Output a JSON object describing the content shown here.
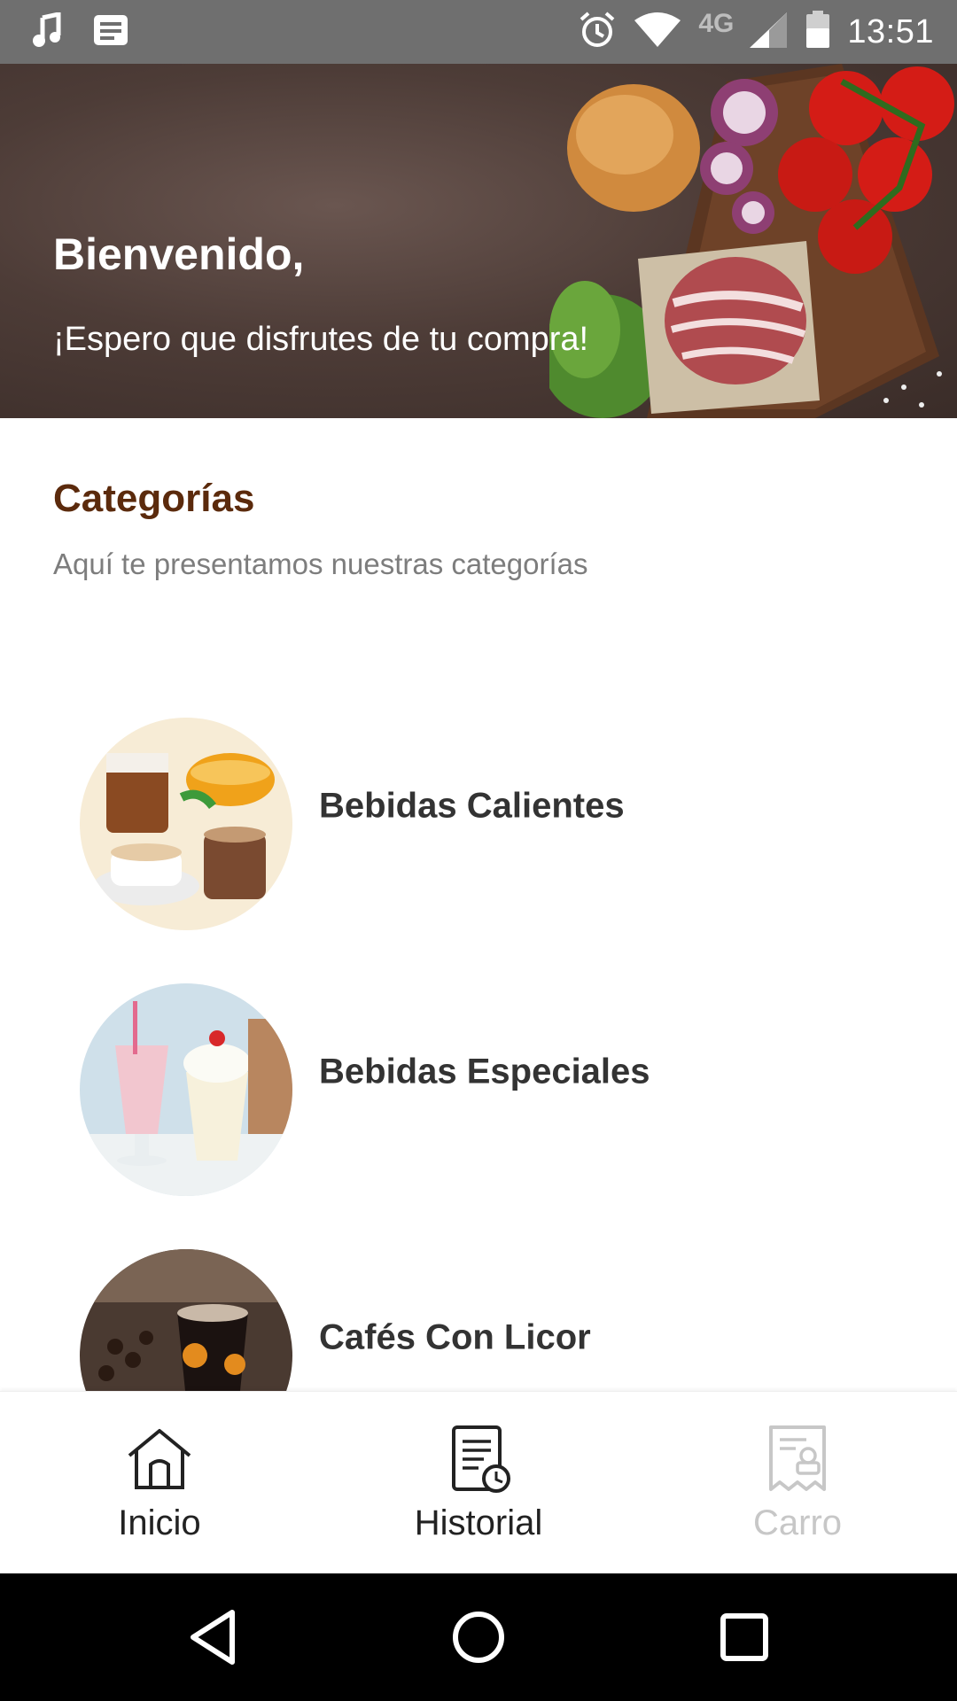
{
  "status_bar": {
    "time": "13:51",
    "network": "4G",
    "icons": [
      "music-note-icon",
      "document-icon",
      "alarm-icon",
      "wifi-icon",
      "cell-signal-icon",
      "battery-icon"
    ]
  },
  "hero": {
    "title": "Bienvenido,",
    "subtitle": "¡Espero que disfrutes de tu compra!"
  },
  "categories": {
    "title": "Categorías",
    "subtitle": "Aquí te presentamos nuestras categorías",
    "items": [
      {
        "label": "Bebidas Calientes"
      },
      {
        "label": "Bebidas Especiales"
      },
      {
        "label": "Cafés Con Licor"
      }
    ]
  },
  "bottom_nav": {
    "items": [
      {
        "label": "Inicio",
        "icon": "home-icon",
        "enabled": true
      },
      {
        "label": "Historial",
        "icon": "history-icon",
        "enabled": true
      },
      {
        "label": "Carro",
        "icon": "cart-receipt-icon",
        "enabled": false
      }
    ]
  },
  "colors": {
    "status_bar": "#6f6f6f",
    "accent_title": "#5b2a0c",
    "muted_text": "#7d7d7d",
    "disabled_text": "#c7c7c7"
  }
}
